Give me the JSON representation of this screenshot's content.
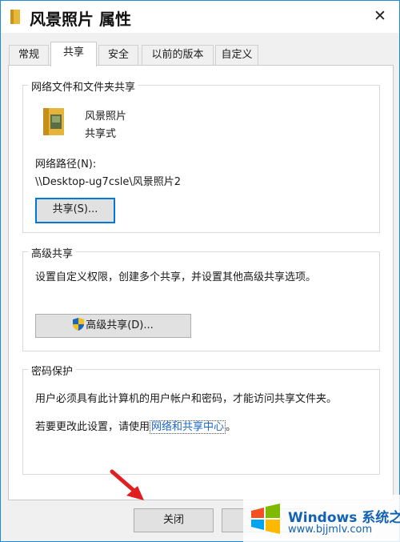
{
  "window": {
    "title": "风景照片 属性",
    "close_glyph": "✕"
  },
  "tabs": [
    {
      "label": "常规",
      "active": false
    },
    {
      "label": "共享",
      "active": true
    },
    {
      "label": "安全",
      "active": false
    },
    {
      "label": "以前的版本",
      "active": false
    },
    {
      "label": "自定义",
      "active": false
    }
  ],
  "network_share": {
    "group_title": "网络文件和文件夹共享",
    "folder_name": "风景照片",
    "share_status": "共享式",
    "path_label": "网络路径(N):",
    "path_value": "\\\\Desktop-ug7csle\\风景照片2",
    "share_button": "共享(S)..."
  },
  "advanced_share": {
    "group_title": "高级共享",
    "description": "设置自定义权限，创建多个共享，并设置其他高级共享选项。",
    "button": "高级共享(D)..."
  },
  "password": {
    "group_title": "密码保护",
    "line1": "用户必须具有此计算机的用户帐户和密码，才能访问共享文件夹。",
    "line2_prefix": "若要更改此设置，请使用",
    "link": "网络和共享中心",
    "line2_suffix": "。"
  },
  "footer": {
    "close_button": "关闭"
  },
  "watermark": {
    "title": "Windows 系统之家",
    "url": "www.bjjmlv.com"
  },
  "colors": {
    "accent": "#0078d7",
    "link": "#1b66c9",
    "arrow": "#e02020"
  },
  "icons": {
    "title": "folder-icon",
    "close": "close-icon",
    "shield": "uac-shield-icon"
  }
}
